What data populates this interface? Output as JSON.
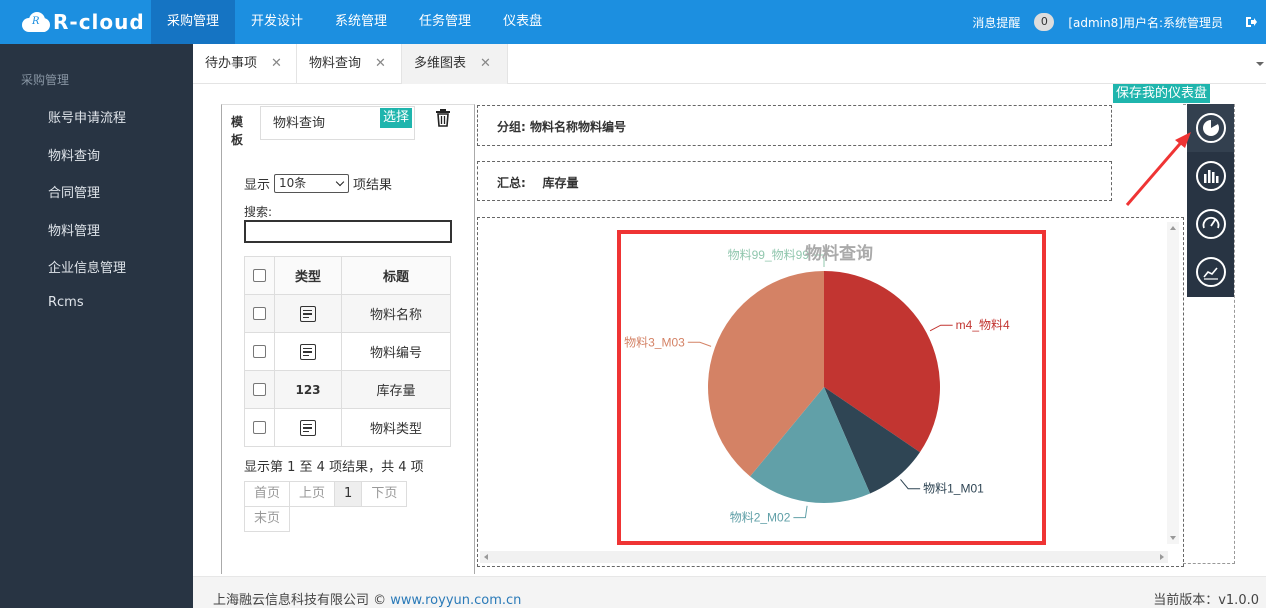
{
  "app": {
    "name": "R-cloud",
    "logo_letter": "R"
  },
  "topnav": {
    "items": [
      {
        "label": "采购管理",
        "active": true
      },
      {
        "label": "开发设计"
      },
      {
        "label": "系统管理"
      },
      {
        "label": "任务管理"
      },
      {
        "label": "仪表盘"
      }
    ],
    "notify_label": "消息提醒",
    "notify_count": "0",
    "user_label": "[admin8]用户名:系统管理员",
    "logout_icon": "logout-icon"
  },
  "sidebar": {
    "title": "采购管理",
    "items": [
      {
        "label": "账号申请流程"
      },
      {
        "label": "物料查询"
      },
      {
        "label": "合同管理"
      },
      {
        "label": "物料管理"
      },
      {
        "label": "企业信息管理"
      },
      {
        "label": "Rcms"
      }
    ]
  },
  "tabs": [
    {
      "label": "待办事项",
      "close": "✕"
    },
    {
      "label": "物料查询",
      "close": "✕"
    },
    {
      "label": "多维图表",
      "close": "✕",
      "active": true
    }
  ],
  "template": {
    "label": "模板",
    "value": "物料查询",
    "select_label": "选择",
    "show_prefix": "显示",
    "page_size": "10条",
    "show_suffix": "项结果",
    "search_label": "搜索:",
    "search_value": "",
    "table_headers": [
      "类型",
      "标题"
    ],
    "rows": [
      {
        "type_icon": "text-field-icon",
        "title": "物料名称"
      },
      {
        "type_icon": "text-field-icon",
        "title": "物料编号"
      },
      {
        "type_text": "123",
        "title": "库存量"
      },
      {
        "type_icon": "text-field-icon",
        "title": "物料类型"
      }
    ],
    "page_info": "显示第 1 至 4 项结果，共 4 项",
    "pager": [
      "首页",
      "上页",
      "1",
      "下页",
      "末页"
    ]
  },
  "group": {
    "label": "分组:",
    "value": "物料名称物料编号"
  },
  "summary": {
    "label": "汇总:",
    "value": "库存量"
  },
  "save_dashboard_label": "保存我的仪表盘",
  "tools": [
    {
      "icon": "pie-chart-icon",
      "active": true
    },
    {
      "icon": "bar-chart-icon"
    },
    {
      "icon": "gauge-icon"
    },
    {
      "icon": "line-chart-icon"
    }
  ],
  "colors": {
    "primary": "#1c8fe0",
    "sidebar": "#283443",
    "teal": "#1fb5ad",
    "frame": "#ef3434"
  },
  "chart_data": {
    "type": "pie",
    "title": "物料查询",
    "slices": [
      {
        "label": "m4_物料4",
        "value": 34.5,
        "color": "#c23531"
      },
      {
        "label": "物料1_M01",
        "value": 9.0,
        "color": "#2f4554"
      },
      {
        "label": "物料2_M02",
        "value": 17.5,
        "color": "#61a0a8"
      },
      {
        "label": "物料3_M03",
        "value": 39.0,
        "color": "#d48265"
      },
      {
        "label": "物料99_物料99",
        "value": 0.0,
        "color": "#91c7ae"
      }
    ]
  },
  "footer": {
    "company": "上海融云信息科技有限公司 ©",
    "site": "www.royyun.com.cn",
    "version_label": "当前版本：",
    "version": "v1.0.0"
  }
}
